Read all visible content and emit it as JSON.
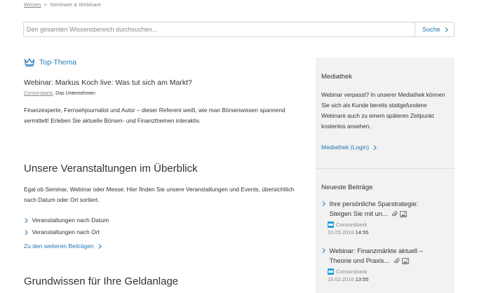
{
  "breadcrumb": {
    "items": [
      "Wissen",
      "Seminare & Webinare"
    ],
    "separator": ">"
  },
  "search": {
    "placeholder": "Den gesamten Wissensbereich durchsuchen...",
    "button_label": "Suche"
  },
  "top_thema": {
    "label": "Top-Thema",
    "title": "Webinar: Markus Koch live: Was tut sich am Markt?",
    "source_brand": "Consorsbank",
    "source_desc": "Das Unternehmen",
    "description": "Finanzexperte, Fernsehjournalist und Autor – dieser Referent weiß, wie man Börsenwissen spannend vermittelt! Erleben Sie aktuelle Börsen- und Finanzthemen interaktiv."
  },
  "events": {
    "heading": "Unsere Veranstaltungen im Überblick",
    "description": "Egal ob Seminar, Webinar oder Messe: Hier finden Sie unsere Veranstaltungen und Events, übersichtlich nach Datum oder Ort sortiert.",
    "links": [
      "Veranstaltungen nach Datum",
      "Veranstaltungen nach Ort"
    ],
    "more_label": "Zu den weiteren Beiträgen"
  },
  "basics": {
    "heading": "Grundwissen für Ihre Geldanlage"
  },
  "sidebar": {
    "mediathek": {
      "heading": "Mediathek",
      "text": "Webinar verpasst? In unserer Mediathek können Sie sich als Kunde bereits stattgefundene Webinare auch zu einem späteren Zeitpunkt kostenlos ansehen.",
      "link_label": "Mediathek (Login)"
    },
    "latest": {
      "heading": "Neueste Beiträge",
      "posts": [
        {
          "line1": "Ihre persönliche Sparstrategie:",
          "line2": "Steigen Sie mit un...",
          "source": "Consorsbank",
          "date": "10.05.2016",
          "time": "14:55"
        },
        {
          "line1": "Webinar: Finanzmärkte aktuell –",
          "line2": "Theorie und Praxis...",
          "source": "Consorsbank",
          "date": "16.02.2016",
          "time": "13:55"
        }
      ]
    }
  },
  "colors": {
    "accent": "#2479b8",
    "sidebar_bg": "#f2f2f2",
    "brand_logo": "#1e9fd6"
  },
  "icons": [
    "crown-icon",
    "chevron-right-icon",
    "attachment-icon",
    "image-icon"
  ]
}
